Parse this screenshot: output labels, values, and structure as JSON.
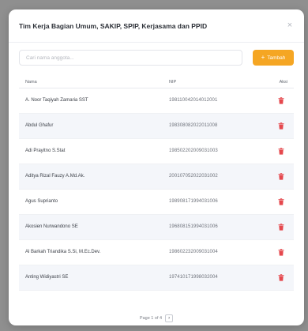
{
  "modal": {
    "title": "Tim Kerja Bagian Umum, SAKIP, SPIP, Kerjasama dan PPID",
    "close_glyph": "×"
  },
  "search": {
    "placeholder": "Cari nama anggota...",
    "value": ""
  },
  "add_button": {
    "label": "Tambah",
    "icon": "plus-icon"
  },
  "table": {
    "headers": {
      "name": "Nama",
      "nip": "NIP",
      "action": "Aksi"
    },
    "rows": [
      {
        "name": "A. Noor Taqiyah Zamaria SST",
        "nip": "198110042014012001"
      },
      {
        "name": "Abdul Ghafur",
        "nip": "198308082022011008"
      },
      {
        "name": "Adi Prayitno S.Stat",
        "nip": "198502202009031003"
      },
      {
        "name": "Aditya Rizal Fauzy A.Md.Ak.",
        "nip": "200107052022031002"
      },
      {
        "name": "Agus Suprianto",
        "nip": "198908171994031006"
      },
      {
        "name": "Akosien Nurwandono SE",
        "nip": "196808151994031006"
      },
      {
        "name": "Al Barkah Triandika S.Si, M.Ec.Dev.",
        "nip": "198602232009031004"
      },
      {
        "name": "Anting Widiyastri SE",
        "nip": "197410171998032004"
      }
    ],
    "delete_icon": "trash-icon",
    "delete_color": "#e5484d"
  },
  "pagination": {
    "text": "Page 1 of 4",
    "next_glyph": "›"
  },
  "colors": {
    "accent": "#f5a623",
    "overlay": "#8f8f8f"
  }
}
